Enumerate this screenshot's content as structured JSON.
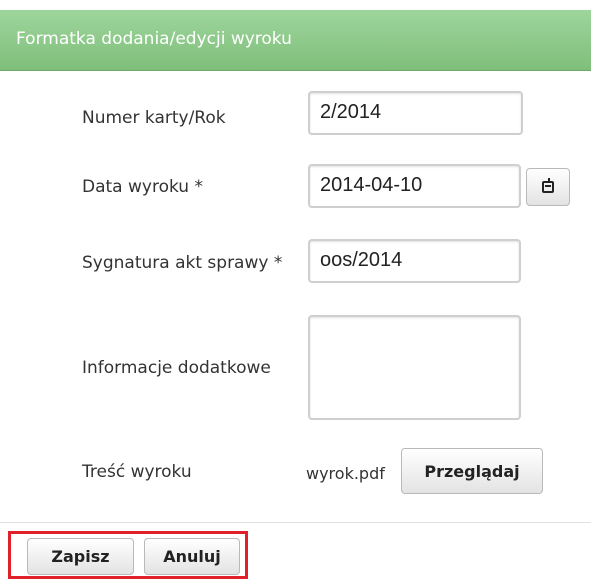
{
  "dialog": {
    "title": "Formatka dodania/edycji wyroku"
  },
  "form": {
    "card_number": {
      "label": "Numer karty/Rok",
      "value": "2/2014"
    },
    "verdict_date": {
      "label": "Data wyroku *",
      "value": "2014-04-10",
      "icon": "calendar-icon"
    },
    "case_signature": {
      "label": "Sygnatura akt sprawy *",
      "value": "oos/2014"
    },
    "additional_info": {
      "label": "Informacje dodatkowe",
      "value": ""
    },
    "verdict_content": {
      "label": "Treść wyroku",
      "file_name": "wyrok.pdf",
      "browse_label": "Przeglądaj"
    }
  },
  "footer": {
    "save_label": "Zapisz",
    "cancel_label": "Anuluj",
    "highlight_color": "#e0202a"
  },
  "colors": {
    "title_bar": "#8cc989",
    "title_text": "#ffffff"
  }
}
